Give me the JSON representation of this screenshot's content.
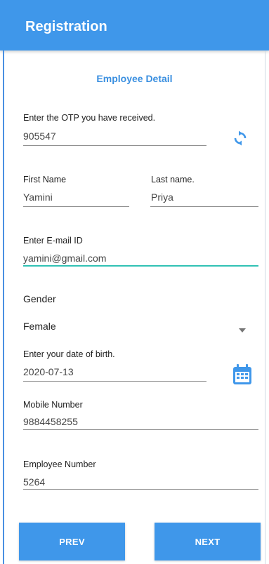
{
  "appbar": {
    "title": "Registration"
  },
  "form": {
    "section_title": "Employee Detail",
    "otp": {
      "label": "Enter the OTP you have received.",
      "value": "905547"
    },
    "first_name": {
      "label": "First Name",
      "value": "Yamini"
    },
    "last_name": {
      "label": "Last name.",
      "value": "Priya"
    },
    "email": {
      "label": "Enter E-mail ID",
      "value": "yamini@gmail.com"
    },
    "gender": {
      "label": "Gender",
      "value": "Female"
    },
    "dob": {
      "label": "Enter your date of birth.",
      "value": "2020-07-13"
    },
    "mobile": {
      "label": "Mobile Number",
      "value": "9884458255"
    },
    "employee_number": {
      "label": "Employee Number",
      "value": "5264"
    }
  },
  "buttons": {
    "prev": "PREV",
    "next": "NEXT"
  },
  "icons": {
    "refresh": "refresh-icon",
    "calendar": "calendar-icon",
    "dropdown": "dropdown-arrow-icon"
  },
  "colors": {
    "primary": "#3f97ea",
    "active_underline": "#31c1b4",
    "section_title": "#3a8fe0"
  }
}
